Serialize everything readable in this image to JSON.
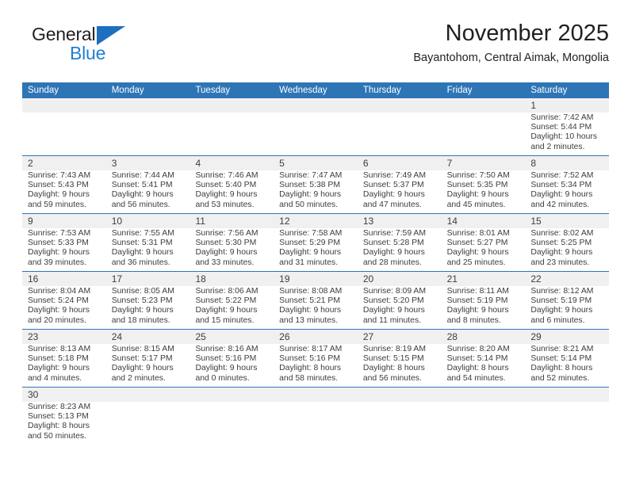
{
  "brand": {
    "name_top": "General",
    "name_bottom": "Blue",
    "triangle_icon": "blue-triangle-icon",
    "color_dark": "#231f20",
    "color_blue": "#1f7fd4"
  },
  "header": {
    "month_title": "November 2025",
    "location": "Bayantohom, Central Aimak, Mongolia"
  },
  "theme": {
    "header_bar": "#2e75b6",
    "daynum_band": "#f0f0f0",
    "row_rule": "#2e75b6",
    "text": "#3d3d3d"
  },
  "weekdays": [
    "Sunday",
    "Monday",
    "Tuesday",
    "Wednesday",
    "Thursday",
    "Friday",
    "Saturday"
  ],
  "weeks": [
    [
      {
        "day": "",
        "lines": [
          "",
          "",
          "",
          ""
        ]
      },
      {
        "day": "",
        "lines": [
          "",
          "",
          "",
          ""
        ]
      },
      {
        "day": "",
        "lines": [
          "",
          "",
          "",
          ""
        ]
      },
      {
        "day": "",
        "lines": [
          "",
          "",
          "",
          ""
        ]
      },
      {
        "day": "",
        "lines": [
          "",
          "",
          "",
          ""
        ]
      },
      {
        "day": "",
        "lines": [
          "",
          "",
          "",
          ""
        ]
      },
      {
        "day": "1",
        "lines": [
          "Sunrise: 7:42 AM",
          "Sunset: 5:44 PM",
          "Daylight: 10 hours",
          "and 2 minutes."
        ]
      }
    ],
    [
      {
        "day": "2",
        "lines": [
          "Sunrise: 7:43 AM",
          "Sunset: 5:43 PM",
          "Daylight: 9 hours",
          "and 59 minutes."
        ]
      },
      {
        "day": "3",
        "lines": [
          "Sunrise: 7:44 AM",
          "Sunset: 5:41 PM",
          "Daylight: 9 hours",
          "and 56 minutes."
        ]
      },
      {
        "day": "4",
        "lines": [
          "Sunrise: 7:46 AM",
          "Sunset: 5:40 PM",
          "Daylight: 9 hours",
          "and 53 minutes."
        ]
      },
      {
        "day": "5",
        "lines": [
          "Sunrise: 7:47 AM",
          "Sunset: 5:38 PM",
          "Daylight: 9 hours",
          "and 50 minutes."
        ]
      },
      {
        "day": "6",
        "lines": [
          "Sunrise: 7:49 AM",
          "Sunset: 5:37 PM",
          "Daylight: 9 hours",
          "and 47 minutes."
        ]
      },
      {
        "day": "7",
        "lines": [
          "Sunrise: 7:50 AM",
          "Sunset: 5:35 PM",
          "Daylight: 9 hours",
          "and 45 minutes."
        ]
      },
      {
        "day": "8",
        "lines": [
          "Sunrise: 7:52 AM",
          "Sunset: 5:34 PM",
          "Daylight: 9 hours",
          "and 42 minutes."
        ]
      }
    ],
    [
      {
        "day": "9",
        "lines": [
          "Sunrise: 7:53 AM",
          "Sunset: 5:33 PM",
          "Daylight: 9 hours",
          "and 39 minutes."
        ]
      },
      {
        "day": "10",
        "lines": [
          "Sunrise: 7:55 AM",
          "Sunset: 5:31 PM",
          "Daylight: 9 hours",
          "and 36 minutes."
        ]
      },
      {
        "day": "11",
        "lines": [
          "Sunrise: 7:56 AM",
          "Sunset: 5:30 PM",
          "Daylight: 9 hours",
          "and 33 minutes."
        ]
      },
      {
        "day": "12",
        "lines": [
          "Sunrise: 7:58 AM",
          "Sunset: 5:29 PM",
          "Daylight: 9 hours",
          "and 31 minutes."
        ]
      },
      {
        "day": "13",
        "lines": [
          "Sunrise: 7:59 AM",
          "Sunset: 5:28 PM",
          "Daylight: 9 hours",
          "and 28 minutes."
        ]
      },
      {
        "day": "14",
        "lines": [
          "Sunrise: 8:01 AM",
          "Sunset: 5:27 PM",
          "Daylight: 9 hours",
          "and 25 minutes."
        ]
      },
      {
        "day": "15",
        "lines": [
          "Sunrise: 8:02 AM",
          "Sunset: 5:25 PM",
          "Daylight: 9 hours",
          "and 23 minutes."
        ]
      }
    ],
    [
      {
        "day": "16",
        "lines": [
          "Sunrise: 8:04 AM",
          "Sunset: 5:24 PM",
          "Daylight: 9 hours",
          "and 20 minutes."
        ]
      },
      {
        "day": "17",
        "lines": [
          "Sunrise: 8:05 AM",
          "Sunset: 5:23 PM",
          "Daylight: 9 hours",
          "and 18 minutes."
        ]
      },
      {
        "day": "18",
        "lines": [
          "Sunrise: 8:06 AM",
          "Sunset: 5:22 PM",
          "Daylight: 9 hours",
          "and 15 minutes."
        ]
      },
      {
        "day": "19",
        "lines": [
          "Sunrise: 8:08 AM",
          "Sunset: 5:21 PM",
          "Daylight: 9 hours",
          "and 13 minutes."
        ]
      },
      {
        "day": "20",
        "lines": [
          "Sunrise: 8:09 AM",
          "Sunset: 5:20 PM",
          "Daylight: 9 hours",
          "and 11 minutes."
        ]
      },
      {
        "day": "21",
        "lines": [
          "Sunrise: 8:11 AM",
          "Sunset: 5:19 PM",
          "Daylight: 9 hours",
          "and 8 minutes."
        ]
      },
      {
        "day": "22",
        "lines": [
          "Sunrise: 8:12 AM",
          "Sunset: 5:19 PM",
          "Daylight: 9 hours",
          "and 6 minutes."
        ]
      }
    ],
    [
      {
        "day": "23",
        "lines": [
          "Sunrise: 8:13 AM",
          "Sunset: 5:18 PM",
          "Daylight: 9 hours",
          "and 4 minutes."
        ]
      },
      {
        "day": "24",
        "lines": [
          "Sunrise: 8:15 AM",
          "Sunset: 5:17 PM",
          "Daylight: 9 hours",
          "and 2 minutes."
        ]
      },
      {
        "day": "25",
        "lines": [
          "Sunrise: 8:16 AM",
          "Sunset: 5:16 PM",
          "Daylight: 9 hours",
          "and 0 minutes."
        ]
      },
      {
        "day": "26",
        "lines": [
          "Sunrise: 8:17 AM",
          "Sunset: 5:16 PM",
          "Daylight: 8 hours",
          "and 58 minutes."
        ]
      },
      {
        "day": "27",
        "lines": [
          "Sunrise: 8:19 AM",
          "Sunset: 5:15 PM",
          "Daylight: 8 hours",
          "and 56 minutes."
        ]
      },
      {
        "day": "28",
        "lines": [
          "Sunrise: 8:20 AM",
          "Sunset: 5:14 PM",
          "Daylight: 8 hours",
          "and 54 minutes."
        ]
      },
      {
        "day": "29",
        "lines": [
          "Sunrise: 8:21 AM",
          "Sunset: 5:14 PM",
          "Daylight: 8 hours",
          "and 52 minutes."
        ]
      }
    ],
    [
      {
        "day": "30",
        "lines": [
          "Sunrise: 8:23 AM",
          "Sunset: 5:13 PM",
          "Daylight: 8 hours",
          "and 50 minutes."
        ]
      },
      {
        "day": "",
        "lines": [
          "",
          "",
          "",
          ""
        ]
      },
      {
        "day": "",
        "lines": [
          "",
          "",
          "",
          ""
        ]
      },
      {
        "day": "",
        "lines": [
          "",
          "",
          "",
          ""
        ]
      },
      {
        "day": "",
        "lines": [
          "",
          "",
          "",
          ""
        ]
      },
      {
        "day": "",
        "lines": [
          "",
          "",
          "",
          ""
        ]
      },
      {
        "day": "",
        "lines": [
          "",
          "",
          "",
          ""
        ]
      }
    ]
  ]
}
